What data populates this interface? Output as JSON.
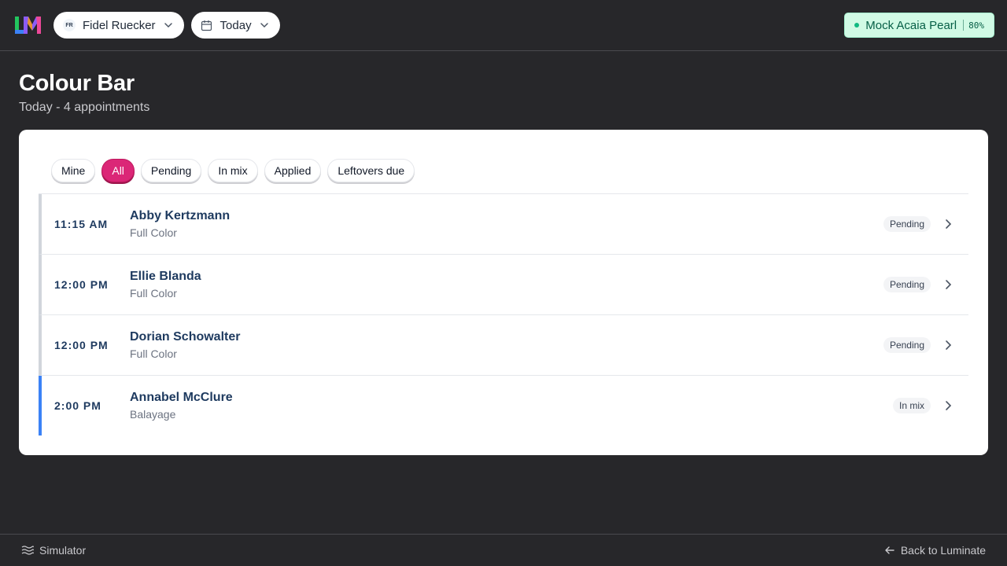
{
  "header": {
    "user": {
      "initials": "FR",
      "name": "Fidel Ruecker"
    },
    "date_filter": "Today",
    "scale": {
      "name": "Mock Acaia Pearl",
      "battery": "80%"
    }
  },
  "page": {
    "title": "Colour Bar",
    "subtitle": "Today - 4 appointments"
  },
  "filters": [
    {
      "label": "Mine",
      "active": false
    },
    {
      "label": "All",
      "active": true
    },
    {
      "label": "Pending",
      "active": false
    },
    {
      "label": "In mix",
      "active": false
    },
    {
      "label": "Applied",
      "active": false
    },
    {
      "label": "Leftovers due",
      "active": false
    }
  ],
  "appointments": [
    {
      "time": "11:15 AM",
      "client": "Abby Kertzmann",
      "service": "Full Color",
      "status": "Pending"
    },
    {
      "time": "12:00 PM",
      "client": "Ellie Blanda",
      "service": "Full Color",
      "status": "Pending"
    },
    {
      "time": "12:00 PM",
      "client": "Dorian Schowalter",
      "service": "Full Color",
      "status": "Pending"
    },
    {
      "time": "2:00 PM",
      "client": "Annabel McClure",
      "service": "Balayage",
      "status": "In mix"
    }
  ],
  "footer": {
    "simulator": "Simulator",
    "back": "Back to Luminate"
  },
  "colors": {
    "accent": "#db2777",
    "in_mix": "#3b82f6",
    "pending": "#d1d5db",
    "scale_ok": "#10b981"
  }
}
